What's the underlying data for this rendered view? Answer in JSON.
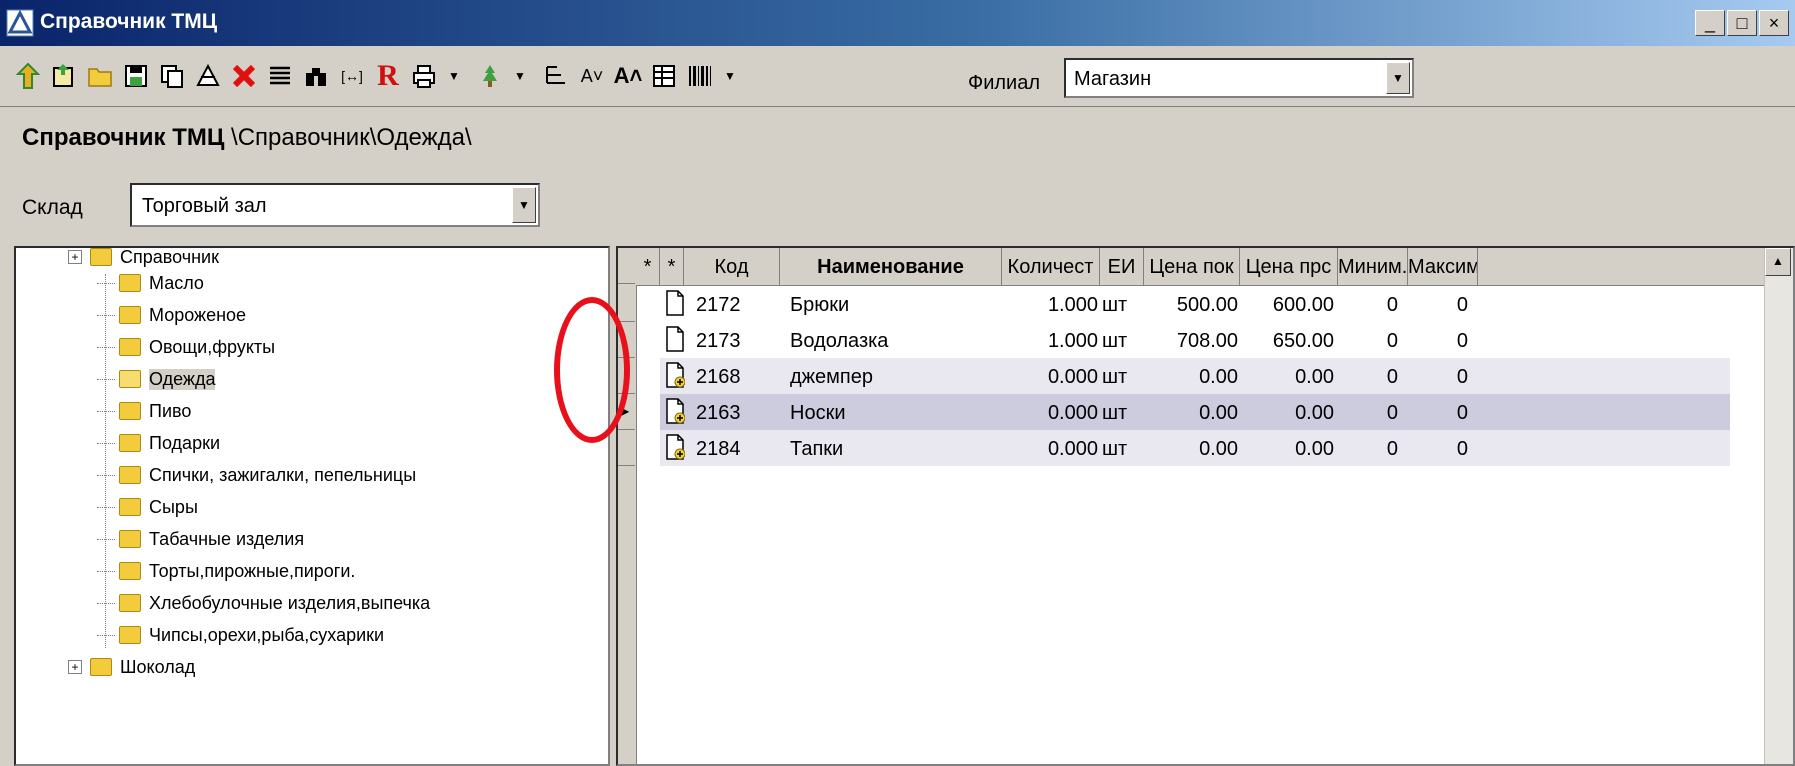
{
  "window": {
    "title": "Справочник ТМЦ",
    "controls": [
      "_",
      "□",
      "×"
    ]
  },
  "toolbar": {
    "icons": [
      "up-arrow-icon",
      "new-folder-icon",
      "folder-icon",
      "save-icon",
      "copy-icon",
      "edit-icon",
      "delete-icon",
      "list-icon",
      "binoculars-icon",
      "brackets-icon",
      "r-icon",
      "print-icon",
      "tree-icon",
      "hierarchy-icon",
      "font-smaller-icon",
      "font-larger-icon",
      "table-icon",
      "barcode-icon"
    ],
    "branch_label": "Филиал",
    "branch_value": "Магазин"
  },
  "path": {
    "bold": "Справочник ТМЦ",
    "rest": " \\Справочник\\Одежда\\"
  },
  "sklad": {
    "label": "Склад",
    "value": "Торговый зал"
  },
  "tree": {
    "root": "Справочник",
    "items": [
      "Масло",
      "Мороженое",
      "Овощи,фрукты",
      "Одежда",
      "Пиво",
      "Подарки",
      "Спички, зажигалки, пепельницы",
      "Сыры",
      "Табачные изделия",
      "Торты,пирожные,пироги.",
      "Хлебобулочные изделия,выпечка",
      "Чипсы,орехи,рыба,сухарики",
      "Шоколад"
    ],
    "selected": "Одежда"
  },
  "grid": {
    "columns": [
      "*",
      "*",
      "Код",
      "Наименование",
      "Количест",
      "ЕИ",
      "Цена пок",
      "Цена прс",
      "Миним.",
      "Максим"
    ],
    "rows": [
      {
        "code": "2172",
        "name": "Брюки",
        "qty": "1.000",
        "unit": "шт",
        "buy": "500.00",
        "sell": "600.00",
        "min": "0",
        "max": "0",
        "icon": "document-icon"
      },
      {
        "code": "2173",
        "name": "Водолазка",
        "qty": "1.000",
        "unit": "шт",
        "buy": "708.00",
        "sell": "650.00",
        "min": "0",
        "max": "0",
        "icon": "document-icon"
      },
      {
        "code": "2168",
        "name": "джемпер",
        "qty": "0.000",
        "unit": "шт",
        "buy": "0.00",
        "sell": "0.00",
        "min": "0",
        "max": "0",
        "icon": "document-new-icon"
      },
      {
        "code": "2163",
        "name": "Носки",
        "qty": "0.000",
        "unit": "шт",
        "buy": "0.00",
        "sell": "0.00",
        "min": "0",
        "max": "0",
        "icon": "document-new-icon"
      },
      {
        "code": "2184",
        "name": "Тапки",
        "qty": "0.000",
        "unit": "шт",
        "buy": "0.00",
        "sell": "0.00",
        "min": "0",
        "max": "0",
        "icon": "document-new-icon"
      }
    ]
  },
  "colors": {
    "titlebar": "#0a246a",
    "highlight_oval": "#e8101b",
    "row_alt": "#e9e8f1",
    "row_current": "#cdccde"
  }
}
